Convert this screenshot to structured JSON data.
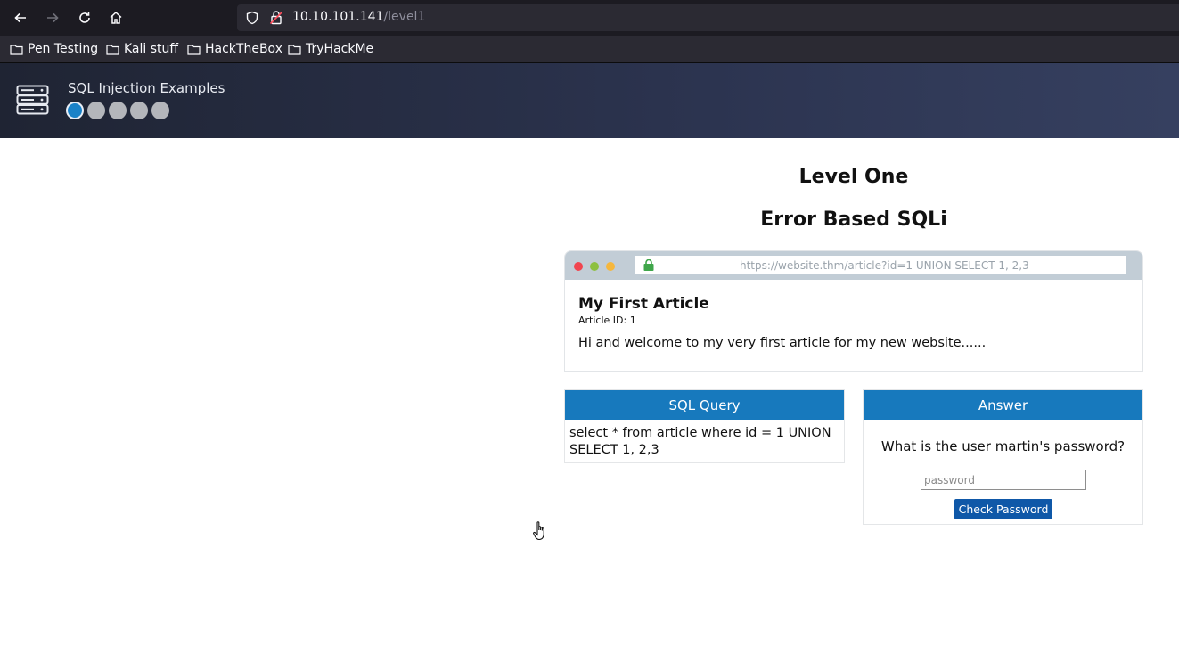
{
  "browser": {
    "url_host": "10.10.101.141",
    "url_path": "/level1",
    "bookmarks": [
      "Pen Testing",
      "Kali stuff",
      "HackTheBox",
      "TryHackMe"
    ]
  },
  "site": {
    "title": "SQL Injection Examples",
    "progress": {
      "total_levels": 5,
      "current_level": 1
    }
  },
  "page": {
    "level_title": "Level One",
    "subtitle": "Error Based SQLi"
  },
  "mock_browser": {
    "url": "https://website.thm/article?id=1 UNION SELECT 1, 2,3",
    "article_title": "My First Article",
    "article_id": "Article ID: 1",
    "article_body": "Hi and welcome to my very first article for my new website......"
  },
  "sql_panel": {
    "heading": "SQL Query",
    "query": "select * from article where id = 1 UNION SELECT 1, 2,3"
  },
  "answer_panel": {
    "heading": "Answer",
    "question": "What is the user martin's password?",
    "placeholder": "password",
    "button_label": "Check Password"
  },
  "colors": {
    "header_bg": "#2c3450",
    "panel_heading": "#1779bd",
    "button": "#0f58a8",
    "progress_active": "#1a82c8"
  }
}
